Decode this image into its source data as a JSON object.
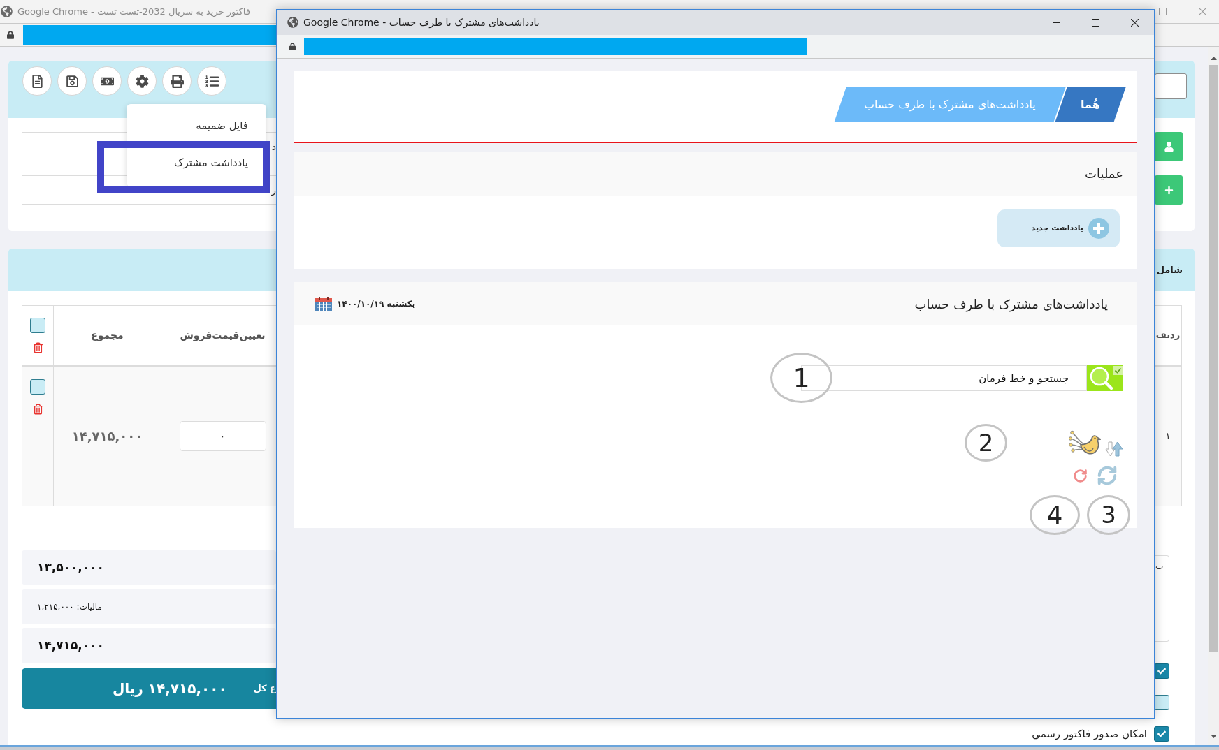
{
  "background_window": {
    "title": "Google Chrome - فاکتور خرید به سریال 2032-تست تست",
    "settings_menu": {
      "items": [
        {
          "label": "فایل ضمیمه",
          "outlined": false
        },
        {
          "label": "یادداشت مشترک",
          "outlined": true
        }
      ]
    },
    "form_fields": [
      "د",
      "ر"
    ],
    "section_title": "شامل",
    "table": {
      "columns": [
        "ردیف",
        "تعیین‌قیمت‌فروش",
        "مجموع"
      ],
      "header_checked": false,
      "rows": [
        {
          "checked": false,
          "total": "۱۴,۷۱۵,۰۰۰",
          "sale_price": "۰",
          "row_number": "۱"
        }
      ]
    },
    "summary": [
      {
        "kind": "amount",
        "text": "۱۳,۵۰۰,۰۰۰"
      },
      {
        "kind": "tax",
        "text": "مالیات: ۱,۲۱۵,۰۰۰"
      },
      {
        "kind": "amount",
        "text": "۱۴,۷۱۵,۰۰۰"
      }
    ],
    "grand_total": {
      "label": "ع کل",
      "value": "۱۴,۷۱۵,۰۰۰ ریال"
    },
    "side_box_text": "ت",
    "options": [
      {
        "checked": true
      },
      {
        "checked": false
      },
      {
        "checked": true,
        "label": "امکان صدور فاکتور رسمی"
      }
    ]
  },
  "popup_window": {
    "title": "Google Chrome - یادداشت‌های مشترک با طرف حساب",
    "breadcrumb": [
      {
        "label": "هُما",
        "current": false
      },
      {
        "label": "یادداشت‌های مشترک با طرف حساب",
        "current": true
      }
    ],
    "operations": {
      "title": "عملیات",
      "buttons": [
        {
          "label": "یادداشت جدید"
        }
      ]
    },
    "notes_panel": {
      "title": "یادداشت‌های مشترک با طرف حساب",
      "date": "یکشنبه ۱۴۰۰/۱۰/۱۹",
      "search": {
        "value": "جستجو و خط فرمان"
      }
    },
    "callouts": [
      "1",
      "2",
      "3",
      "4"
    ]
  }
}
